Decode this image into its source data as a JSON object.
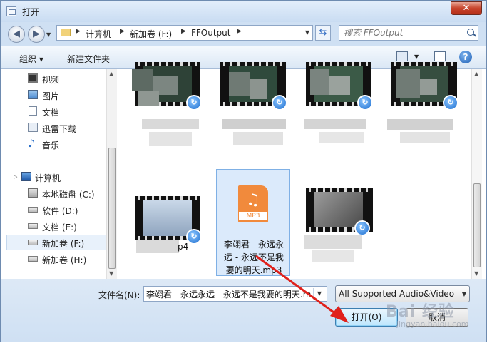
{
  "window": {
    "title": "打开",
    "close_label": "✕"
  },
  "nav": {
    "breadcrumb": [
      "计算机",
      "新加卷 (F:)",
      "FFOutput"
    ],
    "search_placeholder": "搜索 FFOutput"
  },
  "toolbar": {
    "organize_label": "组织 ▾",
    "new_folder_label": "新建文件夹",
    "help_label": "?"
  },
  "sidebar": {
    "items": [
      {
        "label": "视频",
        "icon": "video-icon"
      },
      {
        "label": "图片",
        "icon": "picture-icon"
      },
      {
        "label": "文档",
        "icon": "document-icon"
      },
      {
        "label": "迅雷下载",
        "icon": "download-icon"
      },
      {
        "label": "音乐",
        "icon": "music-icon"
      },
      {
        "label": "计算机",
        "icon": "computer-icon"
      },
      {
        "label": "本地磁盘 (C:)",
        "icon": "system-drive-icon"
      },
      {
        "label": "软件 (D:)",
        "icon": "drive-icon"
      },
      {
        "label": "文档 (E:)",
        "icon": "drive-icon"
      },
      {
        "label": "新加卷 (F:)",
        "icon": "drive-icon"
      },
      {
        "label": "新加卷 (H:)",
        "icon": "drive-icon"
      }
    ],
    "selected": "新加卷 (F:)"
  },
  "files": [
    {
      "name": "",
      "type": "video",
      "blurred": true
    },
    {
      "name": "",
      "type": "video",
      "blurred": true
    },
    {
      "name": "",
      "type": "video",
      "blurred": true
    },
    {
      "name": "",
      "type": "video",
      "blurred": true
    },
    {
      "name": "p4",
      "type": "video",
      "blurred": true
    },
    {
      "name": "李翊君 - 永远永远 - 永远不是我要的明天.mp3",
      "name_lines": [
        "李翊君 - 永远永",
        "远 - 永远不是我",
        "要的明天.mp3"
      ],
      "type": "audio",
      "format_badge": "MP3",
      "selected": true
    },
    {
      "name": "",
      "type": "video",
      "blurred": true
    }
  ],
  "footer": {
    "filename_label": "文件名(N):",
    "filename_value": "李翊君 - 永远永远 - 永远不是我要的明天.mp",
    "filetype_value": "All Supported Audio&Video",
    "open_label": "打开(O)",
    "cancel_label": "取消"
  },
  "watermark": {
    "text": "Bai 经验",
    "url": "jingyan.baidu.com"
  }
}
